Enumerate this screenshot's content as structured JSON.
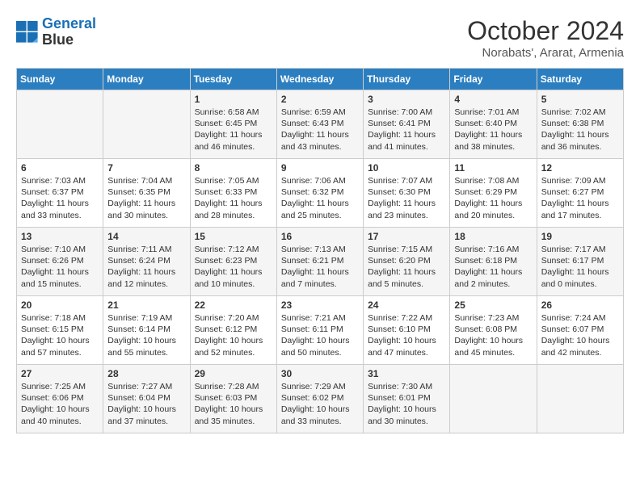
{
  "header": {
    "logo_line1": "General",
    "logo_line2": "Blue",
    "month": "October 2024",
    "location": "Norabats', Ararat, Armenia"
  },
  "days_of_week": [
    "Sunday",
    "Monday",
    "Tuesday",
    "Wednesday",
    "Thursday",
    "Friday",
    "Saturday"
  ],
  "weeks": [
    [
      {
        "day": "",
        "content": ""
      },
      {
        "day": "",
        "content": ""
      },
      {
        "day": "1",
        "content": "Sunrise: 6:58 AM\nSunset: 6:45 PM\nDaylight: 11 hours and 46 minutes."
      },
      {
        "day": "2",
        "content": "Sunrise: 6:59 AM\nSunset: 6:43 PM\nDaylight: 11 hours and 43 minutes."
      },
      {
        "day": "3",
        "content": "Sunrise: 7:00 AM\nSunset: 6:41 PM\nDaylight: 11 hours and 41 minutes."
      },
      {
        "day": "4",
        "content": "Sunrise: 7:01 AM\nSunset: 6:40 PM\nDaylight: 11 hours and 38 minutes."
      },
      {
        "day": "5",
        "content": "Sunrise: 7:02 AM\nSunset: 6:38 PM\nDaylight: 11 hours and 36 minutes."
      }
    ],
    [
      {
        "day": "6",
        "content": "Sunrise: 7:03 AM\nSunset: 6:37 PM\nDaylight: 11 hours and 33 minutes."
      },
      {
        "day": "7",
        "content": "Sunrise: 7:04 AM\nSunset: 6:35 PM\nDaylight: 11 hours and 30 minutes."
      },
      {
        "day": "8",
        "content": "Sunrise: 7:05 AM\nSunset: 6:33 PM\nDaylight: 11 hours and 28 minutes."
      },
      {
        "day": "9",
        "content": "Sunrise: 7:06 AM\nSunset: 6:32 PM\nDaylight: 11 hours and 25 minutes."
      },
      {
        "day": "10",
        "content": "Sunrise: 7:07 AM\nSunset: 6:30 PM\nDaylight: 11 hours and 23 minutes."
      },
      {
        "day": "11",
        "content": "Sunrise: 7:08 AM\nSunset: 6:29 PM\nDaylight: 11 hours and 20 minutes."
      },
      {
        "day": "12",
        "content": "Sunrise: 7:09 AM\nSunset: 6:27 PM\nDaylight: 11 hours and 17 minutes."
      }
    ],
    [
      {
        "day": "13",
        "content": "Sunrise: 7:10 AM\nSunset: 6:26 PM\nDaylight: 11 hours and 15 minutes."
      },
      {
        "day": "14",
        "content": "Sunrise: 7:11 AM\nSunset: 6:24 PM\nDaylight: 11 hours and 12 minutes."
      },
      {
        "day": "15",
        "content": "Sunrise: 7:12 AM\nSunset: 6:23 PM\nDaylight: 11 hours and 10 minutes."
      },
      {
        "day": "16",
        "content": "Sunrise: 7:13 AM\nSunset: 6:21 PM\nDaylight: 11 hours and 7 minutes."
      },
      {
        "day": "17",
        "content": "Sunrise: 7:15 AM\nSunset: 6:20 PM\nDaylight: 11 hours and 5 minutes."
      },
      {
        "day": "18",
        "content": "Sunrise: 7:16 AM\nSunset: 6:18 PM\nDaylight: 11 hours and 2 minutes."
      },
      {
        "day": "19",
        "content": "Sunrise: 7:17 AM\nSunset: 6:17 PM\nDaylight: 11 hours and 0 minutes."
      }
    ],
    [
      {
        "day": "20",
        "content": "Sunrise: 7:18 AM\nSunset: 6:15 PM\nDaylight: 10 hours and 57 minutes."
      },
      {
        "day": "21",
        "content": "Sunrise: 7:19 AM\nSunset: 6:14 PM\nDaylight: 10 hours and 55 minutes."
      },
      {
        "day": "22",
        "content": "Sunrise: 7:20 AM\nSunset: 6:12 PM\nDaylight: 10 hours and 52 minutes."
      },
      {
        "day": "23",
        "content": "Sunrise: 7:21 AM\nSunset: 6:11 PM\nDaylight: 10 hours and 50 minutes."
      },
      {
        "day": "24",
        "content": "Sunrise: 7:22 AM\nSunset: 6:10 PM\nDaylight: 10 hours and 47 minutes."
      },
      {
        "day": "25",
        "content": "Sunrise: 7:23 AM\nSunset: 6:08 PM\nDaylight: 10 hours and 45 minutes."
      },
      {
        "day": "26",
        "content": "Sunrise: 7:24 AM\nSunset: 6:07 PM\nDaylight: 10 hours and 42 minutes."
      }
    ],
    [
      {
        "day": "27",
        "content": "Sunrise: 7:25 AM\nSunset: 6:06 PM\nDaylight: 10 hours and 40 minutes."
      },
      {
        "day": "28",
        "content": "Sunrise: 7:27 AM\nSunset: 6:04 PM\nDaylight: 10 hours and 37 minutes."
      },
      {
        "day": "29",
        "content": "Sunrise: 7:28 AM\nSunset: 6:03 PM\nDaylight: 10 hours and 35 minutes."
      },
      {
        "day": "30",
        "content": "Sunrise: 7:29 AM\nSunset: 6:02 PM\nDaylight: 10 hours and 33 minutes."
      },
      {
        "day": "31",
        "content": "Sunrise: 7:30 AM\nSunset: 6:01 PM\nDaylight: 10 hours and 30 minutes."
      },
      {
        "day": "",
        "content": ""
      },
      {
        "day": "",
        "content": ""
      }
    ]
  ]
}
